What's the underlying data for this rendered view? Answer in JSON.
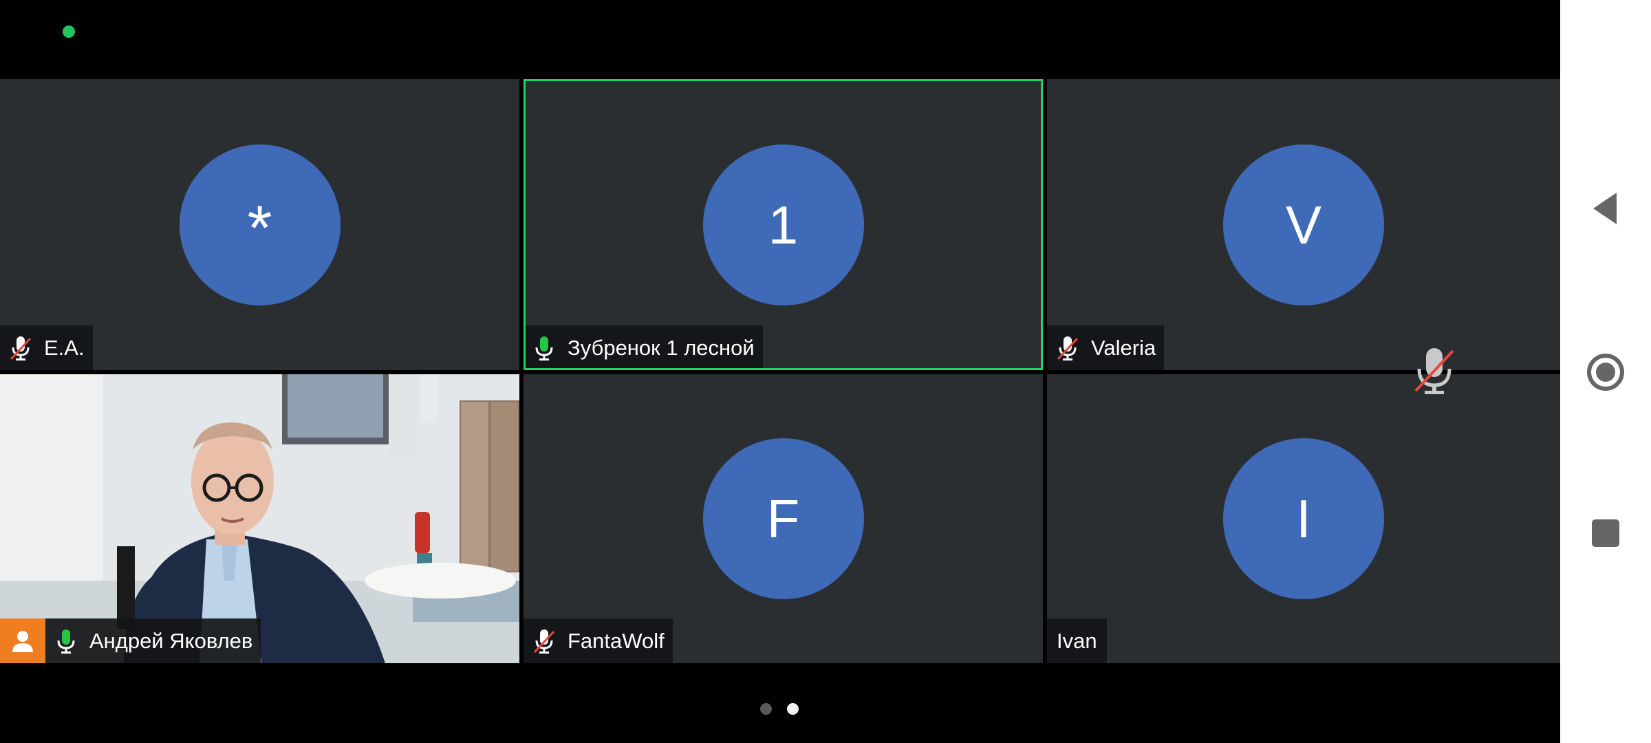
{
  "status": {
    "indicator_color": "#22c55e"
  },
  "participants": [
    {
      "initial": "*",
      "name": "E.A.",
      "mic": "muted",
      "active": false
    },
    {
      "initial": "1",
      "name": "Зубренок 1 лесной",
      "mic": "on",
      "active": true
    },
    {
      "initial": "V",
      "name": "Valeria",
      "mic": "muted",
      "active": false
    },
    {
      "initial": "",
      "name": "Андрей Яковлев",
      "mic": "on",
      "active": false,
      "video": true,
      "host": true
    },
    {
      "initial": "F",
      "name": "FantaWolf",
      "mic": "muted",
      "active": false
    },
    {
      "initial": "I",
      "name": "Ivan",
      "mic": "none",
      "active": false
    }
  ],
  "pager": {
    "pages": 2,
    "current": 2
  },
  "colors": {
    "tile_bg": "#2b2e31",
    "avatar_bg": "#3e6ab7",
    "active_border": "#1fd367",
    "mic_on": "#25c644",
    "mic_muted_slash": "#e8453c",
    "host_badge": "#f07d20"
  },
  "nav": {
    "back": "back-icon",
    "home": "home-icon",
    "recents": "recents-icon"
  }
}
